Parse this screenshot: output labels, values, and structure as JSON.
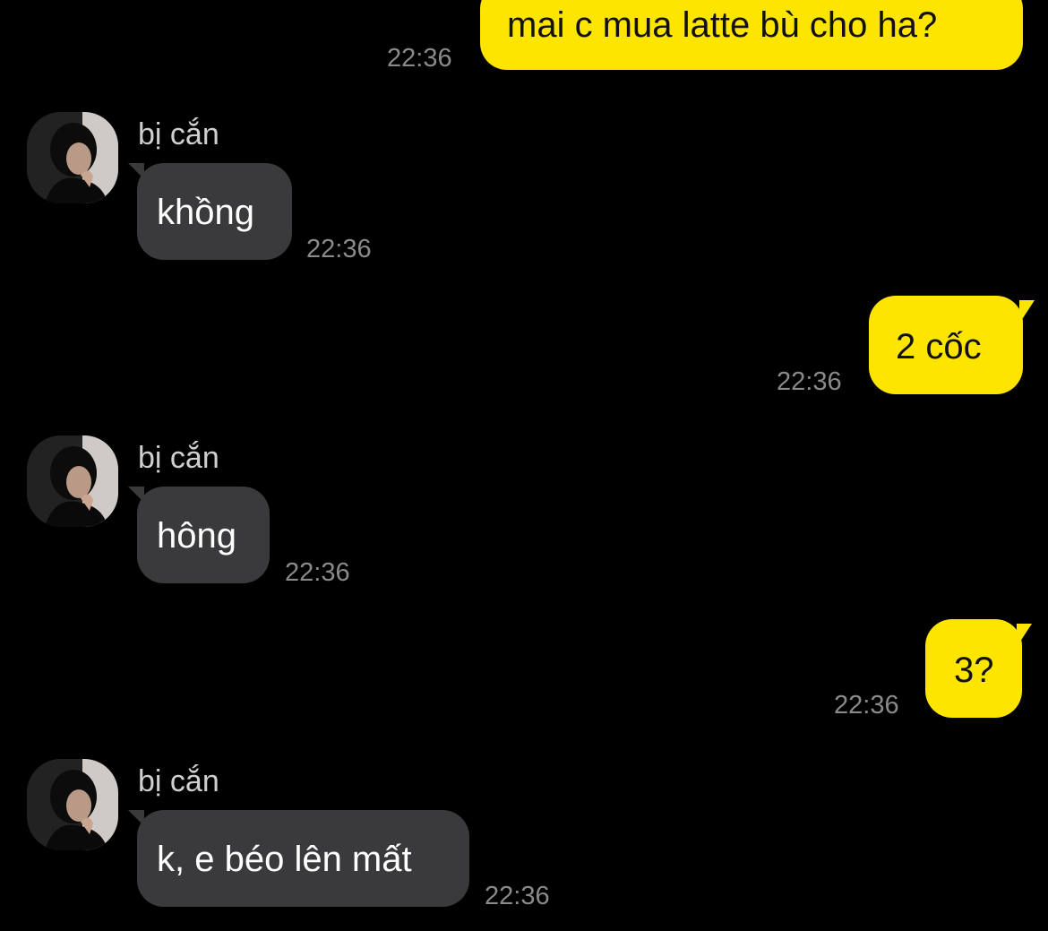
{
  "colors": {
    "background": "#000000",
    "outgoing_bubble": "#FEE500",
    "incoming_bubble": "#3A3A3C",
    "timestamp": "#8A8A8A"
  },
  "messages": [
    {
      "direction": "outgoing",
      "text": "mai c mua latte bù cho ha?",
      "time": "22:36"
    },
    {
      "direction": "incoming",
      "sender": "bị cắn",
      "avatar": "avatar-photo",
      "text": "khồng",
      "time": "22:36"
    },
    {
      "direction": "outgoing",
      "text": "2 cốc",
      "time": "22:36"
    },
    {
      "direction": "incoming",
      "sender": "bị cắn",
      "avatar": "avatar-photo",
      "text": "hông",
      "time": "22:36"
    },
    {
      "direction": "outgoing",
      "text": "3?",
      "time": "22:36"
    },
    {
      "direction": "incoming",
      "sender": "bị cắn",
      "avatar": "avatar-photo",
      "text": "k, e béo lên mất",
      "time": "22:36"
    }
  ]
}
